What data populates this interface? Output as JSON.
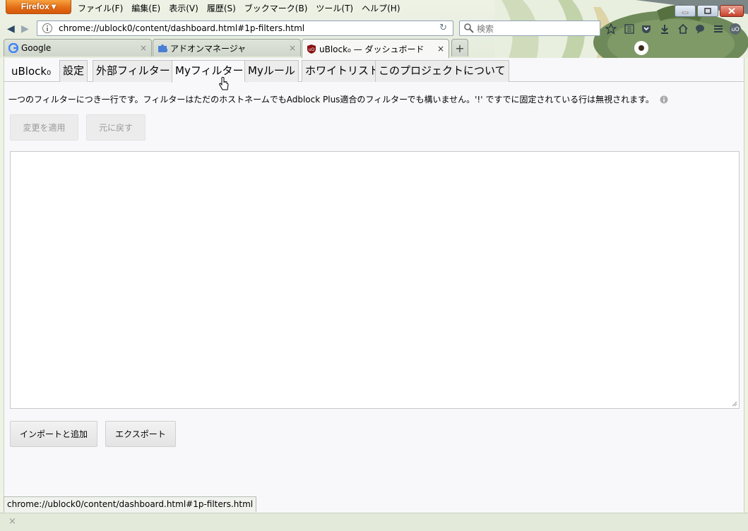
{
  "browser": {
    "app_button": "Firefox",
    "menu": [
      "ファイル(F)",
      "編集(E)",
      "表示(V)",
      "履歴(S)",
      "ブックマーク(B)",
      "ツール(T)",
      "ヘルプ(H)"
    ],
    "url": "chrome://ublock0/content/dashboard.html#1p-filters.html",
    "search_placeholder": "検索",
    "tabs": [
      {
        "label": "Google",
        "icon": "google-icon"
      },
      {
        "label": "アドオンマネージャ",
        "icon": "puzzle-icon"
      },
      {
        "label": "uBlock₀ — ダッシュボード",
        "icon": "ublock-icon",
        "active": true
      }
    ],
    "new_tab": "+",
    "status_url": "chrome://ublock0/content/dashboard.html#1p-filters.html",
    "addonbar_close": "×"
  },
  "dashboard": {
    "brand": "uBlock₀",
    "tabs": [
      "設定",
      "外部フィルター",
      "Myフィルター",
      "Myルール",
      "ホワイトリスト",
      "このプロジェクトについて"
    ],
    "active_tab": "Myフィルター",
    "intro": "一つのフィルターにつき一行です。フィルターはただのホストネームでもAdblock Plus適合のフィルターでも構いません。'!' ですでに固定されている行は無視されます。",
    "apply_button": "変更を適用",
    "revert_button": "元に戻す",
    "editor_value": "",
    "import_button": "インポートと追加",
    "export_button": "エクスポート"
  }
}
